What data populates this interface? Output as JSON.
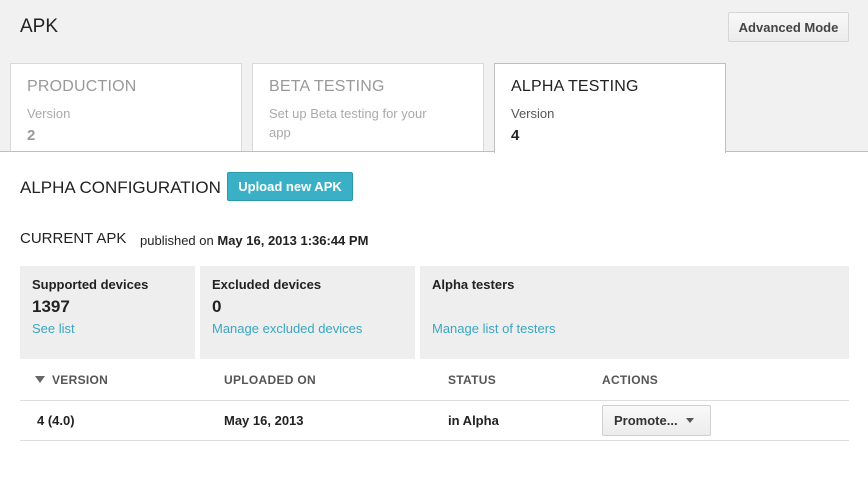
{
  "header": {
    "title": "APK",
    "advanced_mode_label": "Advanced Mode"
  },
  "tabs": [
    {
      "title": "PRODUCTION",
      "subtitle": "Version",
      "number": "2",
      "active": false
    },
    {
      "title": "BETA TESTING",
      "subtitle": "Set up Beta testing for your app",
      "number": "",
      "active": false
    },
    {
      "title": "ALPHA TESTING",
      "subtitle": "Version",
      "number": "4",
      "active": true
    }
  ],
  "config": {
    "title": "ALPHA CONFIGURATION",
    "upload_label": "Upload new APK"
  },
  "current_apk": {
    "label": "CURRENT APK",
    "published_prefix": "published on",
    "published_date": "May 16, 2013 1:36:44 PM"
  },
  "cards": [
    {
      "label": "Supported devices",
      "value": "1397",
      "link": "See list"
    },
    {
      "label": "Excluded devices",
      "value": "0",
      "link": "Manage excluded devices"
    },
    {
      "label": "Alpha testers",
      "value": "",
      "link": "Manage list of testers"
    }
  ],
  "table": {
    "headers": [
      "VERSION",
      "UPLOADED ON",
      "STATUS",
      "ACTIONS"
    ],
    "rows": [
      {
        "version": "4 (4.0)",
        "uploaded_on": "May 16, 2013",
        "status": "in Alpha",
        "action_label": "Promote..."
      }
    ]
  },
  "colors": {
    "accent": "#3ab0c6",
    "link": "#3aa7c0",
    "panel": "#eeeeee"
  }
}
